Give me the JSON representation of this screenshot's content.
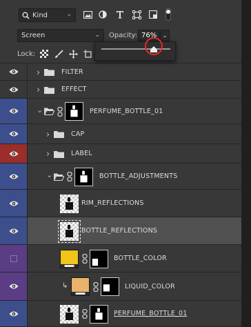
{
  "filter": {
    "kind_label": "Kind",
    "icons": [
      "search-icon",
      "image-filter-icon",
      "adjustment-filter-icon",
      "type-filter-icon",
      "shape-filter-icon",
      "smart-object-filter-icon"
    ]
  },
  "blend": {
    "mode": "Screen",
    "opacity_label": "Opacity:",
    "opacity_value": "76%"
  },
  "lock": {
    "label": "Lock:"
  },
  "opacity_slider": {
    "value_percent": 76,
    "highlight_color": "#e8262d"
  },
  "layers": [
    {
      "name": "FILTER",
      "type": "group",
      "visibility": "plain"
    },
    {
      "name": "EFFECT",
      "type": "group",
      "visibility": "plain"
    },
    {
      "name": "PERFUME_BOTTLE_01",
      "type": "group-masked",
      "visibility": "blue"
    },
    {
      "name": "CAP",
      "type": "group",
      "visibility": "blue"
    },
    {
      "name": "LABEL",
      "type": "group",
      "visibility": "red"
    },
    {
      "name": "BOTTLE_ADJUSTMENTS",
      "type": "group-masked",
      "visibility": "blue"
    },
    {
      "name": "RIM_REFLECTIONS",
      "type": "pixel",
      "visibility": "blue"
    },
    {
      "name": "BOTTLE_REFLECTIONS",
      "type": "pixel",
      "visibility": "blue",
      "selected": true
    },
    {
      "name": "BOTTLE_COLOR",
      "type": "fill-masked",
      "visibility": "violet",
      "fill_color": "#f0c419"
    },
    {
      "name": "LIQUID_COLOR",
      "type": "fill-masked",
      "visibility": "violet",
      "fill_color": "#e8b36a"
    },
    {
      "name": "PERFUME_BOTTLE_01",
      "type": "pixel-masked",
      "visibility": "blue"
    }
  ],
  "colors": {
    "visibility_blue": "#3d4e8c",
    "visibility_red": "#9b2d2a",
    "visibility_violet": "#5a3d85"
  }
}
